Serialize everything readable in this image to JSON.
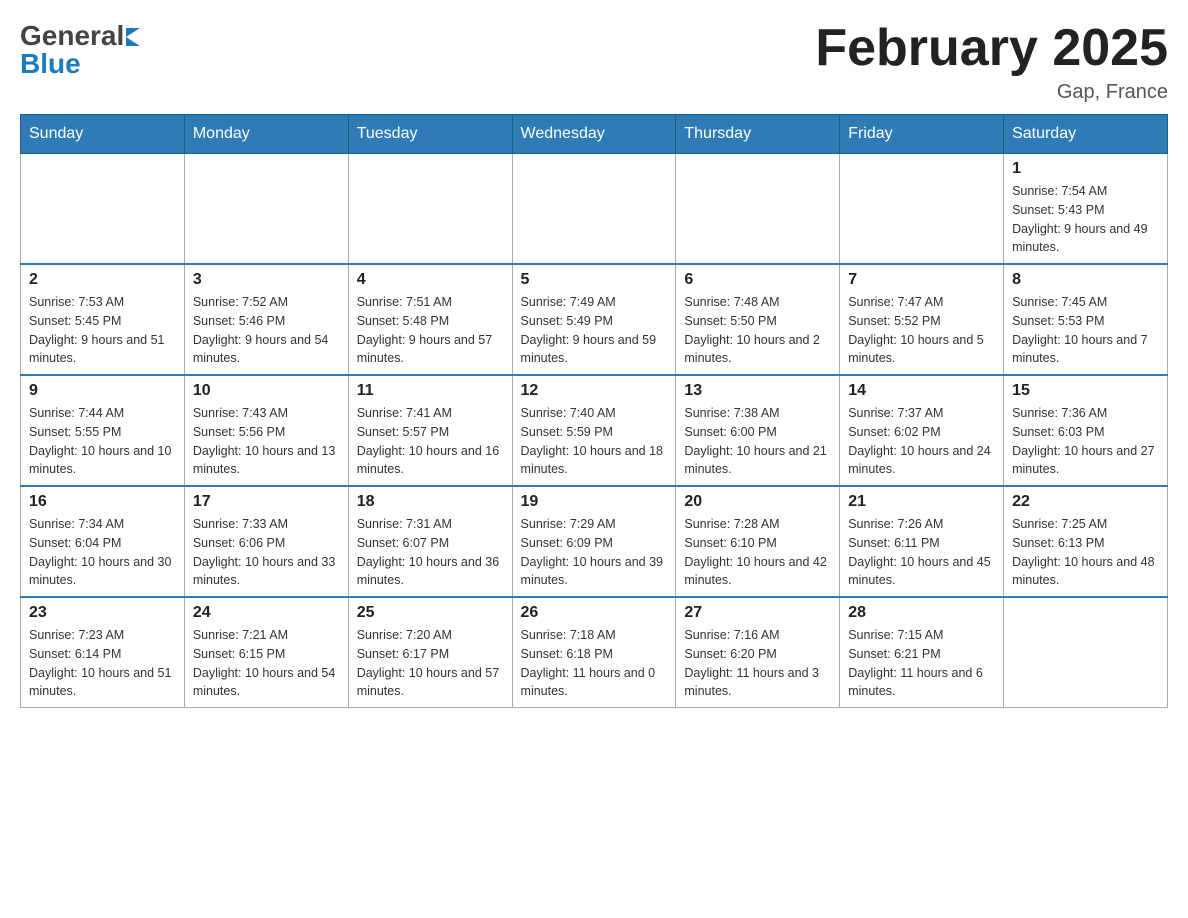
{
  "header": {
    "title": "February 2025",
    "location": "Gap, France",
    "logo_general": "General",
    "logo_blue": "Blue"
  },
  "days_of_week": [
    "Sunday",
    "Monday",
    "Tuesday",
    "Wednesday",
    "Thursday",
    "Friday",
    "Saturday"
  ],
  "weeks": [
    {
      "days": [
        {
          "num": "",
          "info": ""
        },
        {
          "num": "",
          "info": ""
        },
        {
          "num": "",
          "info": ""
        },
        {
          "num": "",
          "info": ""
        },
        {
          "num": "",
          "info": ""
        },
        {
          "num": "",
          "info": ""
        },
        {
          "num": "1",
          "info": "Sunrise: 7:54 AM\nSunset: 5:43 PM\nDaylight: 9 hours and 49 minutes."
        }
      ]
    },
    {
      "days": [
        {
          "num": "2",
          "info": "Sunrise: 7:53 AM\nSunset: 5:45 PM\nDaylight: 9 hours and 51 minutes."
        },
        {
          "num": "3",
          "info": "Sunrise: 7:52 AM\nSunset: 5:46 PM\nDaylight: 9 hours and 54 minutes."
        },
        {
          "num": "4",
          "info": "Sunrise: 7:51 AM\nSunset: 5:48 PM\nDaylight: 9 hours and 57 minutes."
        },
        {
          "num": "5",
          "info": "Sunrise: 7:49 AM\nSunset: 5:49 PM\nDaylight: 9 hours and 59 minutes."
        },
        {
          "num": "6",
          "info": "Sunrise: 7:48 AM\nSunset: 5:50 PM\nDaylight: 10 hours and 2 minutes."
        },
        {
          "num": "7",
          "info": "Sunrise: 7:47 AM\nSunset: 5:52 PM\nDaylight: 10 hours and 5 minutes."
        },
        {
          "num": "8",
          "info": "Sunrise: 7:45 AM\nSunset: 5:53 PM\nDaylight: 10 hours and 7 minutes."
        }
      ]
    },
    {
      "days": [
        {
          "num": "9",
          "info": "Sunrise: 7:44 AM\nSunset: 5:55 PM\nDaylight: 10 hours and 10 minutes."
        },
        {
          "num": "10",
          "info": "Sunrise: 7:43 AM\nSunset: 5:56 PM\nDaylight: 10 hours and 13 minutes."
        },
        {
          "num": "11",
          "info": "Sunrise: 7:41 AM\nSunset: 5:57 PM\nDaylight: 10 hours and 16 minutes."
        },
        {
          "num": "12",
          "info": "Sunrise: 7:40 AM\nSunset: 5:59 PM\nDaylight: 10 hours and 18 minutes."
        },
        {
          "num": "13",
          "info": "Sunrise: 7:38 AM\nSunset: 6:00 PM\nDaylight: 10 hours and 21 minutes."
        },
        {
          "num": "14",
          "info": "Sunrise: 7:37 AM\nSunset: 6:02 PM\nDaylight: 10 hours and 24 minutes."
        },
        {
          "num": "15",
          "info": "Sunrise: 7:36 AM\nSunset: 6:03 PM\nDaylight: 10 hours and 27 minutes."
        }
      ]
    },
    {
      "days": [
        {
          "num": "16",
          "info": "Sunrise: 7:34 AM\nSunset: 6:04 PM\nDaylight: 10 hours and 30 minutes."
        },
        {
          "num": "17",
          "info": "Sunrise: 7:33 AM\nSunset: 6:06 PM\nDaylight: 10 hours and 33 minutes."
        },
        {
          "num": "18",
          "info": "Sunrise: 7:31 AM\nSunset: 6:07 PM\nDaylight: 10 hours and 36 minutes."
        },
        {
          "num": "19",
          "info": "Sunrise: 7:29 AM\nSunset: 6:09 PM\nDaylight: 10 hours and 39 minutes."
        },
        {
          "num": "20",
          "info": "Sunrise: 7:28 AM\nSunset: 6:10 PM\nDaylight: 10 hours and 42 minutes."
        },
        {
          "num": "21",
          "info": "Sunrise: 7:26 AM\nSunset: 6:11 PM\nDaylight: 10 hours and 45 minutes."
        },
        {
          "num": "22",
          "info": "Sunrise: 7:25 AM\nSunset: 6:13 PM\nDaylight: 10 hours and 48 minutes."
        }
      ]
    },
    {
      "days": [
        {
          "num": "23",
          "info": "Sunrise: 7:23 AM\nSunset: 6:14 PM\nDaylight: 10 hours and 51 minutes."
        },
        {
          "num": "24",
          "info": "Sunrise: 7:21 AM\nSunset: 6:15 PM\nDaylight: 10 hours and 54 minutes."
        },
        {
          "num": "25",
          "info": "Sunrise: 7:20 AM\nSunset: 6:17 PM\nDaylight: 10 hours and 57 minutes."
        },
        {
          "num": "26",
          "info": "Sunrise: 7:18 AM\nSunset: 6:18 PM\nDaylight: 11 hours and 0 minutes."
        },
        {
          "num": "27",
          "info": "Sunrise: 7:16 AM\nSunset: 6:20 PM\nDaylight: 11 hours and 3 minutes."
        },
        {
          "num": "28",
          "info": "Sunrise: 7:15 AM\nSunset: 6:21 PM\nDaylight: 11 hours and 6 minutes."
        },
        {
          "num": "",
          "info": ""
        }
      ]
    }
  ]
}
